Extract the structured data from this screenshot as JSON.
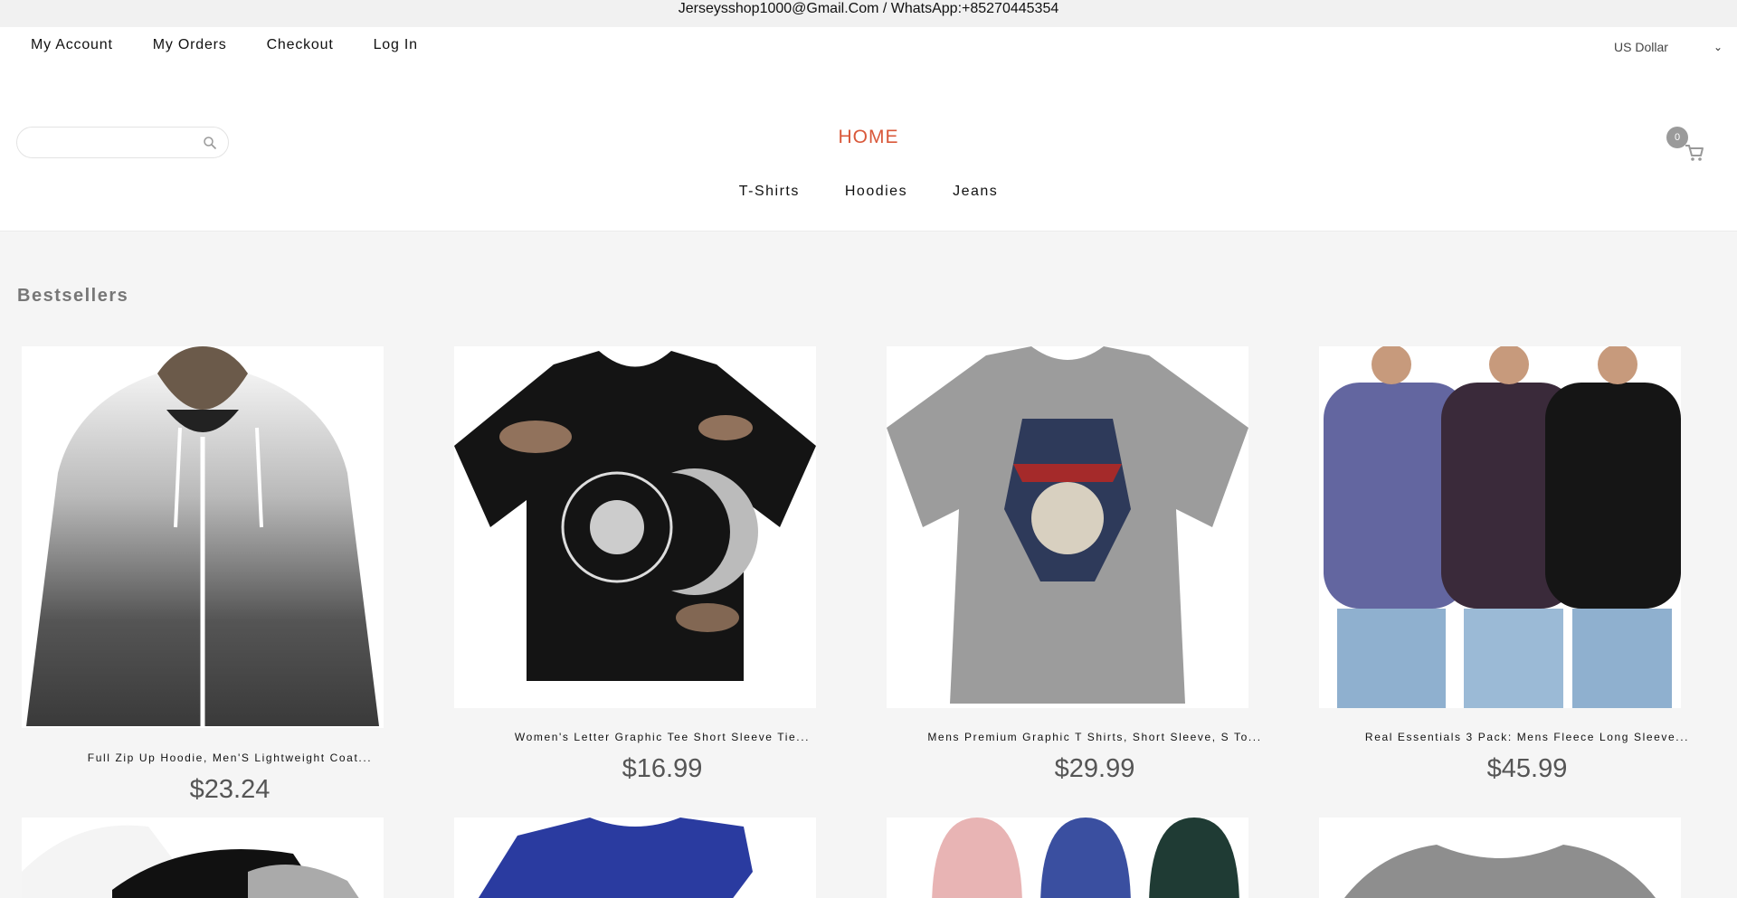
{
  "topbar": {
    "text": "Jerseysshop1000@Gmail.Com / WhatsApp:+85270445354"
  },
  "account_nav": [
    "My Account",
    "My Orders",
    "Checkout",
    "Log In"
  ],
  "currency": {
    "label": "US Dollar"
  },
  "search": {
    "placeholder": ""
  },
  "home": {
    "label": "HOME"
  },
  "cart": {
    "count": "0"
  },
  "category_nav": [
    "T-Shirts",
    "Hoodies",
    "Jeans"
  ],
  "bestsellers": {
    "title": "Bestsellers",
    "products": [
      {
        "title": "Full Zip Up Hoodie, Men'S Lightweight Coat...",
        "price": "$23.24"
      },
      {
        "title": "Women's Letter Graphic Tee Short Sleeve Tie...",
        "price": "$16.99"
      },
      {
        "title": "Mens Premium Graphic T Shirts, Short Sleeve, S To...",
        "price": "$29.99"
      },
      {
        "title": "Real Essentials 3 Pack: Mens Fleece Long Sleeve...",
        "price": "$45.99"
      }
    ]
  },
  "icons": {
    "search": "search-icon",
    "cart": "cart-icon",
    "dropdown": "chevron-down-icon"
  },
  "colors": {
    "accent": "#d9583a",
    "topbar_bg": "#f1f1f1",
    "page_bg": "#f5f5f5",
    "price": "#555555"
  }
}
